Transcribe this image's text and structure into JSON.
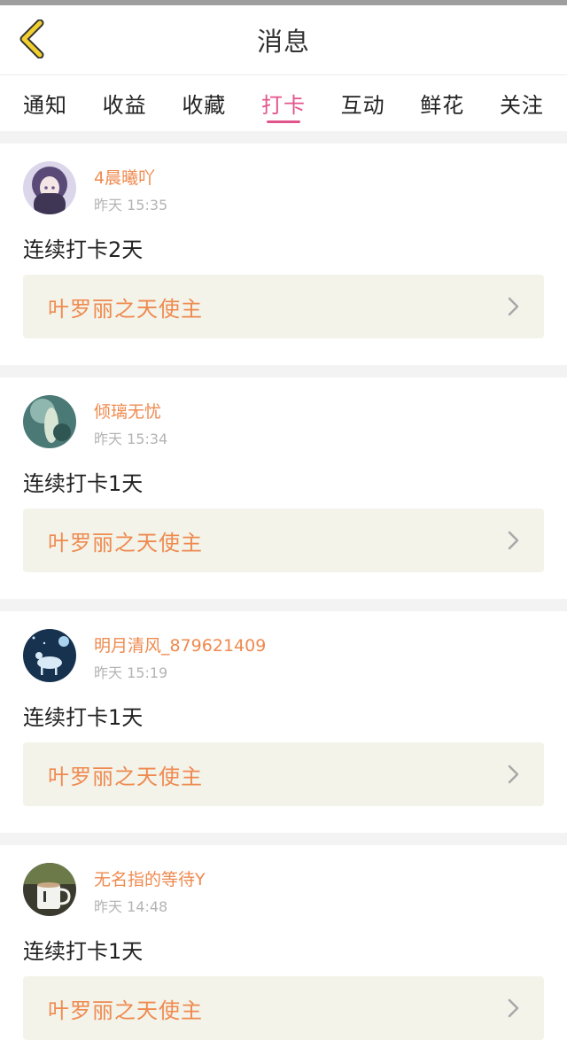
{
  "header": {
    "title": "消息"
  },
  "tabs": [
    {
      "label": "通知"
    },
    {
      "label": "收益"
    },
    {
      "label": "收藏"
    },
    {
      "label": "打卡"
    },
    {
      "label": "互动"
    },
    {
      "label": "鲜花"
    },
    {
      "label": "关注"
    }
  ],
  "active_tab": "打卡",
  "messages": [
    {
      "username": "4晨曦吖",
      "time": "昨天 15:35",
      "content": "连续打卡2天",
      "book": "叶罗丽之天使主"
    },
    {
      "username": "倾璃无忧",
      "time": "昨天 15:34",
      "content": "连续打卡1天",
      "book": "叶罗丽之天使主"
    },
    {
      "username": "明月清风_879621409",
      "time": "昨天 15:19",
      "content": "连续打卡1天",
      "book": "叶罗丽之天使主"
    },
    {
      "username": "无名指的等待Y",
      "time": "昨天 14:48",
      "content": "连续打卡1天",
      "book": "叶罗丽之天使主"
    }
  ],
  "colors": {
    "accent": "#e2558c",
    "username": "#ef8a4f",
    "back_icon": "#f1cf2f",
    "book_bg": "#f3f3ea"
  },
  "icons": {
    "back": "chevron-left-icon",
    "book_arrow": "chevron-right-icon"
  }
}
